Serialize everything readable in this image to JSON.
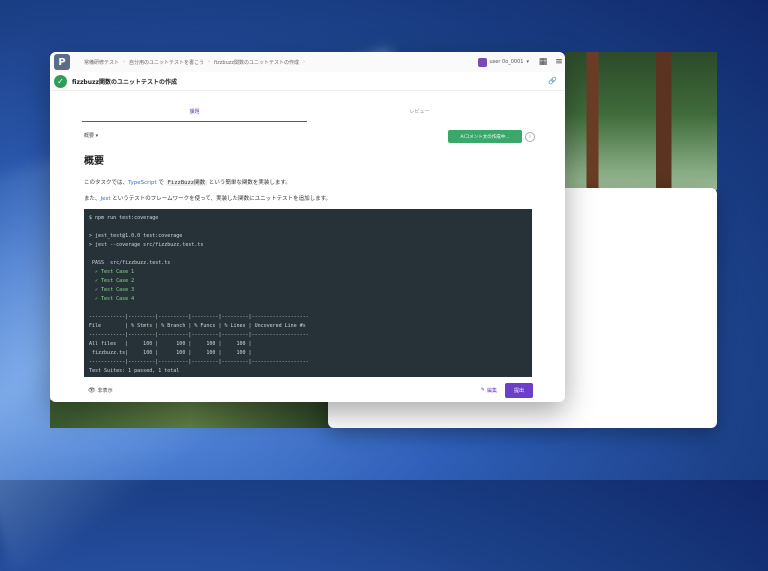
{
  "breadcrumb": [
    "常備研修テスト",
    "自分用のユニットテストを書こう",
    "fizzbuzz関数のユニットテストの作成"
  ],
  "user": {
    "label": "user 0o_0001"
  },
  "task": {
    "title": "fizzbuzz関数のユニットテストの作成"
  },
  "tabs": [
    {
      "label": "課題"
    },
    {
      "label": "レビュー"
    }
  ],
  "language": {
    "selected": "概要"
  },
  "ai_button": {
    "label": "AIコメント文の作成中..."
  },
  "content": {
    "heading": "概要",
    "para1_prefix": "このタスクでは、",
    "para1_link": "TypeScript",
    "para1_mid": " で ",
    "para1_code": "FizzBuzz関数",
    "para1_suffix": " という簡単な関数を実装します。",
    "para2_prefix": "また、",
    "para2_link": "Jest",
    "para2_suffix": " というテストのフレームワークを使って、実装した関数にユニットテストを追加します。"
  },
  "terminal": {
    "lines": [
      "$ npm run test:coverage",
      "",
      "> jest_test@1.0.0 test:coverage",
      "> jest --coverage src/fizzbuzz.test.ts",
      "",
      " PASS  src/fizzbuzz.test.ts",
      "  ✓ Test Case 1",
      "  ✓ Test Case 2",
      "  ✓ Test Case 3",
      "  ✓ Test Case 4",
      "",
      "------------|---------|----------|---------|---------|-------------------",
      "File        | % Stmts | % Branch | % Funcs | % Lines | Uncovered Line #s",
      "------------|---------|----------|---------|---------|-------------------",
      "All files   |     100 |      100 |     100 |     100 |",
      " fizzbuzz.ts|     100 |      100 |     100 |     100 |",
      "------------|---------|----------|---------|---------|-------------------",
      "Test Suites: 1 passed, 1 total"
    ]
  },
  "bottombar": {
    "hide_label": "非表示",
    "edit_label": "編集",
    "submit_label": "提出"
  }
}
